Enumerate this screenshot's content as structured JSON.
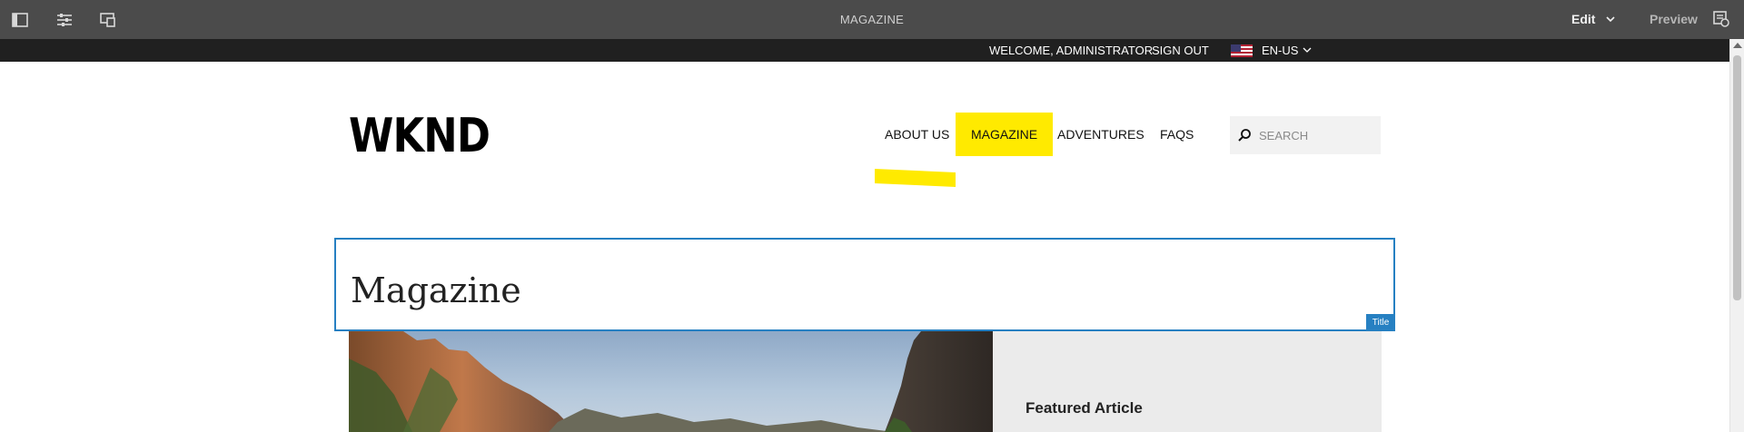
{
  "editor": {
    "page_name": "MAGAZINE",
    "mode_label": "Edit",
    "preview_label": "Preview",
    "accent_color": "#2680c2"
  },
  "utility": {
    "welcome": "WELCOME, ADMINISTRATOR",
    "sign_out": "SIGN OUT",
    "language": "EN-US"
  },
  "site": {
    "logo": "WKND",
    "nav": [
      {
        "label": "ABOUT US",
        "active": false
      },
      {
        "label": "MAGAZINE",
        "active": true
      },
      {
        "label": "ADVENTURES",
        "active": false
      },
      {
        "label": "FAQS",
        "active": false
      }
    ],
    "search_placeholder": "SEARCH",
    "brand_color": "#ffea00"
  },
  "content": {
    "title": "Magazine",
    "component_tag": "Title",
    "featured_label": "Featured Article"
  }
}
